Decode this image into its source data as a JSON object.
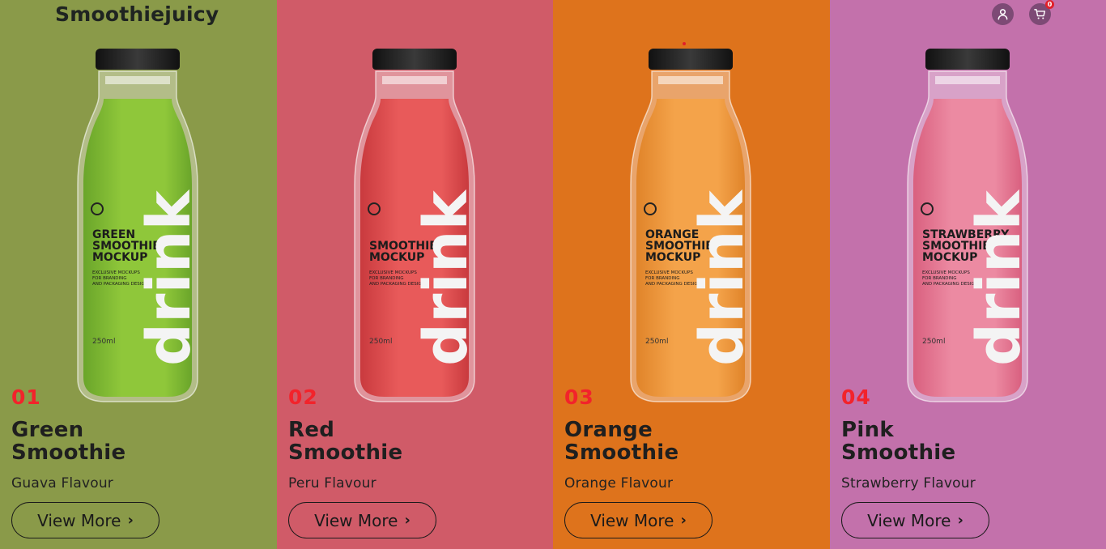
{
  "brand": "Smoothiejuicy",
  "header": {
    "cart_count": "0"
  },
  "products": [
    {
      "number": "01",
      "title_line1": "Green",
      "title_line2": "Smoothie",
      "flavour": "Guava Flavour",
      "button": "View More",
      "bg": "#8a9a49",
      "liquid": "#8fc73a",
      "liquid_dark": "#6aa52a",
      "label": {
        "line1": "GREEN",
        "line2": "SMOOTHIE",
        "line3": "MOCKUP",
        "drink": "drink",
        "small1": "EXCLUSIVE MOCKUPS",
        "small2": "FOR BRANDING",
        "small3": "AND PACKAGING DESIGN",
        "volume": "250ml"
      }
    },
    {
      "number": "02",
      "title_line1": "Red",
      "title_line2": "Smoothie",
      "flavour": "Peru Flavour",
      "button": "View More",
      "bg": "#d05b68",
      "liquid": "#e85a5a",
      "liquid_dark": "#c93a3e",
      "label": {
        "line1": "",
        "line2": "SMOOTHIE",
        "line3": "MOCKUP",
        "drink": "drink",
        "small1": "EXCLUSIVE MOCKUPS",
        "small2": "FOR BRANDING",
        "small3": "AND PACKAGING DESIGN",
        "volume": "250ml"
      }
    },
    {
      "number": "03",
      "title_line1": "Orange",
      "title_line2": "Smoothie",
      "flavour": "Orange Flavour",
      "button": "View More",
      "bg": "#de731c",
      "liquid": "#f4a34a",
      "liquid_dark": "#e0842a",
      "label": {
        "line1": "ORANGE",
        "line2": "SMOOTHIE",
        "line3": "MOCKUP",
        "drink": "drink",
        "small1": "EXCLUSIVE MOCKUPS",
        "small2": "FOR BRANDING",
        "small3": "AND PACKAGING DESIGN",
        "volume": "250ml"
      }
    },
    {
      "number": "04",
      "title_line1": "Pink",
      "title_line2": "Smoothie",
      "flavour": "Strawberry Flavour",
      "button": "View More",
      "bg": "#c371ab",
      "liquid": "#ec8aa2",
      "liquid_dark": "#d9607f",
      "label": {
        "line1": "STRAWBERRY",
        "line2": "SMOOTHIE",
        "line3": "MOCKUP",
        "drink": "drink",
        "small1": "EXCLUSIVE MOCKUPS",
        "small2": "FOR BRANDING",
        "small3": "AND PACKAGING DESIGN",
        "volume": "250ml"
      }
    }
  ]
}
